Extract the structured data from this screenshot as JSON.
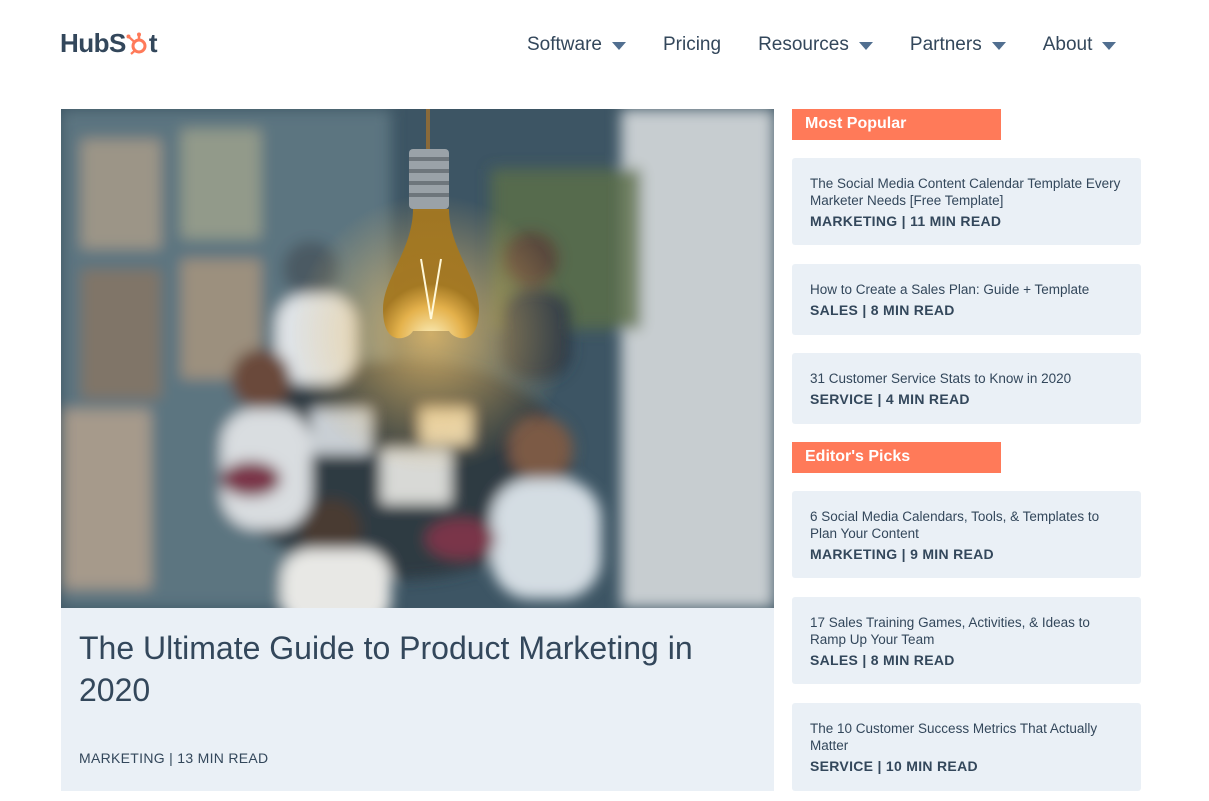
{
  "header": {
    "logo_text": "HubSpot",
    "nav": [
      {
        "label": "Software",
        "has_dropdown": true
      },
      {
        "label": "Pricing",
        "has_dropdown": false
      },
      {
        "label": "Resources",
        "has_dropdown": true
      },
      {
        "label": "Partners",
        "has_dropdown": true
      },
      {
        "label": "About",
        "has_dropdown": true
      }
    ]
  },
  "featured": {
    "title": "The Ultimate Guide to Product Marketing in 2020",
    "meta": "MARKETING | 13 MIN READ",
    "image_icon": "lightbulb-meeting-photo"
  },
  "most_popular": {
    "heading": "Most Popular",
    "items": [
      {
        "title": "The Social Media Content Calendar Template Every Marketer Needs [Free Template]",
        "meta": "MARKETING | 11 MIN READ"
      },
      {
        "title": "How to Create a Sales Plan: Guide + Template",
        "meta": "SALES | 8 MIN READ"
      },
      {
        "title": "31 Customer Service Stats to Know in 2020",
        "meta": "SERVICE | 4 MIN READ"
      }
    ]
  },
  "editors_picks": {
    "heading": "Editor's Picks",
    "items": [
      {
        "title": "6 Social Media Calendars, Tools, & Templates to Plan Your Content",
        "meta": "MARKETING | 9 MIN READ"
      },
      {
        "title": "17 Sales Training Games, Activities, & Ideas to Ramp Up Your Team",
        "meta": "SALES | 8 MIN READ"
      },
      {
        "title": "The 10 Customer Success Metrics That Actually Matter",
        "meta": "SERVICE | 10 MIN READ"
      }
    ]
  },
  "colors": {
    "accent": "#ff7a59",
    "text": "#33475b",
    "card_bg": "#eaf0f6"
  }
}
